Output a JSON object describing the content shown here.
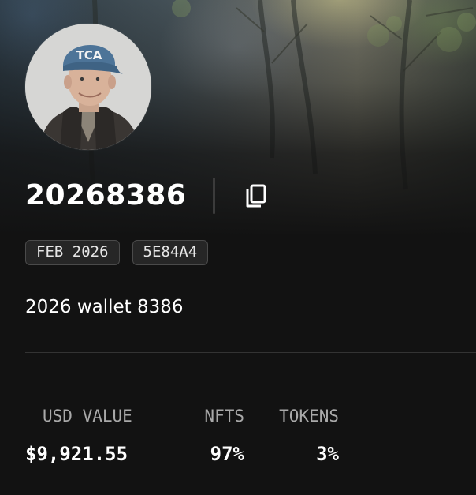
{
  "profile": {
    "avatar_alt": "profile photo",
    "wallet_id": "20268386",
    "copy_icon": "copy-icon",
    "badges": [
      "FEB 2026",
      "5E84A4"
    ],
    "description": "2026 wallet 8386"
  },
  "stats": {
    "usd_value": {
      "label": "USD VALUE",
      "value": "$9,921.55"
    },
    "nfts": {
      "label": "NFTS",
      "value": "97%"
    },
    "tokens": {
      "label": "TOKENS",
      "value": "3%"
    }
  },
  "colors": {
    "background": "#121212",
    "text": "#ffffff",
    "muted_text": "#a9a9a9",
    "badge_bg": "#262626",
    "badge_border": "#4a4a4a",
    "divider": "#333333"
  }
}
